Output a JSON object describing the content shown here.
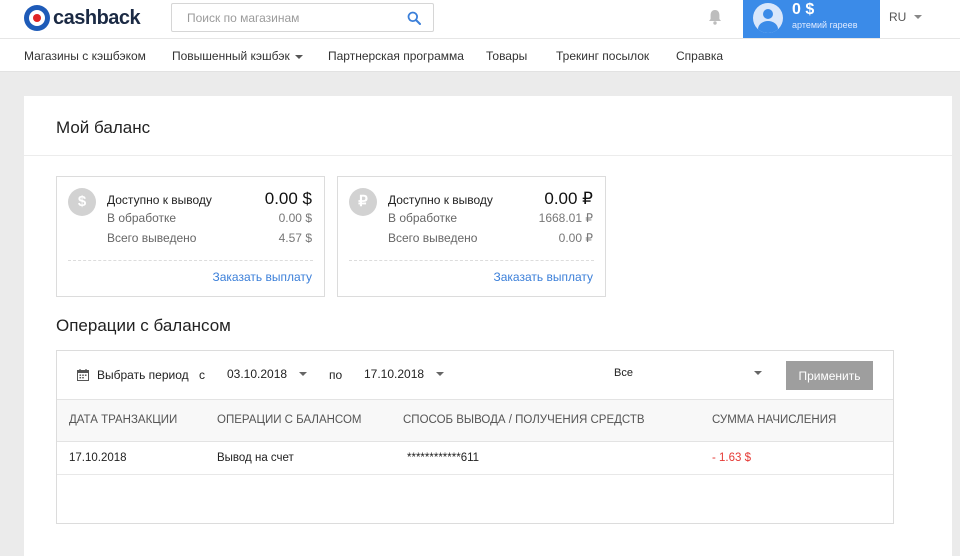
{
  "header": {
    "logo_text": "cashback",
    "search_placeholder": "Поиск по магазинам",
    "user_balance": "0 $",
    "user_name": "артемий гареев",
    "language": "RU"
  },
  "nav": [
    {
      "label": "Магазины с кэшбэком"
    },
    {
      "label": "Повышенный кэшбэк"
    },
    {
      "label": "Партнерская программа"
    },
    {
      "label": "Товары"
    },
    {
      "label": "Трекинг посылок"
    },
    {
      "label": "Справка"
    }
  ],
  "page": {
    "title": "Мой баланс"
  },
  "balances": [
    {
      "icon": "dollar-icon",
      "icon_char": "$",
      "available_label": "Доступно к выводу",
      "available_value": "0.00 $",
      "processing_label": "В обработке",
      "processing_value": "0.00 $",
      "withdrawn_label": "Всего выведено",
      "withdrawn_value": "4.57 $",
      "payout_link": "Заказать выплату"
    },
    {
      "icon": "ruble-icon",
      "icon_char": "₽",
      "available_label": "Доступно к выводу",
      "available_value": "0.00 ₽",
      "processing_label": "В обработке",
      "processing_value": "1668.01 ₽",
      "withdrawn_label": "Всего выведено",
      "withdrawn_value": "0.00 ₽",
      "payout_link": "Заказать выплату"
    }
  ],
  "operations": {
    "title": "Операции с балансом",
    "filter": {
      "period_label": "Выбрать период",
      "from_label": "с",
      "from_value": "03.10.2018",
      "to_label": "по",
      "to_value": "17.10.2018",
      "type_value": "Все",
      "apply_label": "Применить"
    },
    "columns": [
      "ДАТА ТРАНЗАКЦИИ",
      "ОПЕРАЦИИ С БАЛАНСОМ",
      "СПОСОБ ВЫВОДА / ПОЛУЧЕНИЯ СРЕДСТВ",
      "СУММА НАЧИСЛЕНИЯ"
    ],
    "rows": [
      {
        "date": "17.10.2018",
        "operation": "Вывод на счет",
        "method": "************611",
        "amount": "- 1.63 $"
      }
    ]
  },
  "colors": {
    "accent": "#3b8be8",
    "link": "#3b7fd9",
    "negative": "#e53935",
    "button_disabled": "#9e9e9e"
  }
}
